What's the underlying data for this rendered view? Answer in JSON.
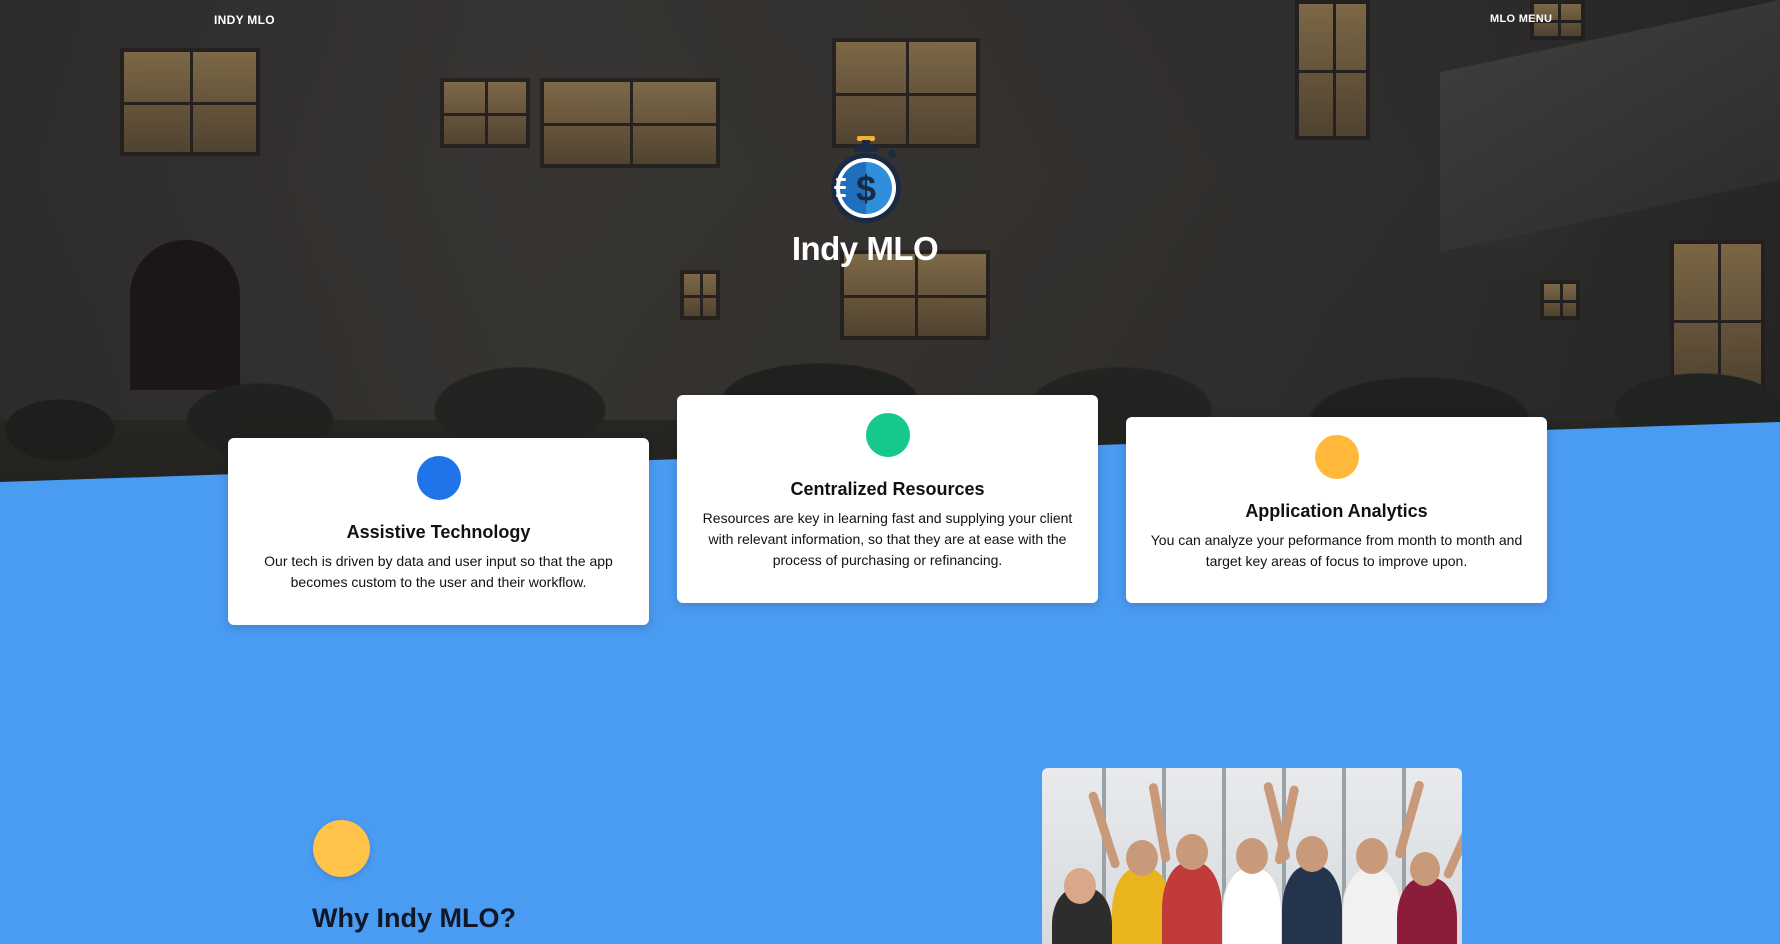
{
  "nav": {
    "brand": "INDY MLO",
    "menu_label": "MLO MENU"
  },
  "hero": {
    "title": "Indy MLO",
    "logo_icon": "stopwatch-dollar-icon"
  },
  "colors": {
    "section_blue": "#4a9bf2",
    "dot_blue": "#1f74ea",
    "dot_green": "#14c98b",
    "dot_orange": "#ffb83a",
    "dot_yellow": "#ffc34a"
  },
  "features": [
    {
      "title": "Assistive Technology",
      "description": "Our tech is driven by data and user input so that the app becomes custom to the user and their workflow."
    },
    {
      "title": "Centralized Resources",
      "description": "Resources are key in learning fast and supplying your client with relevant information, so that they are at ease with the process of purchasing or refinancing."
    },
    {
      "title": "Application Analytics",
      "description": "You can analyze your peformance from month to month and target key areas of focus to improve upon."
    }
  ],
  "why": {
    "title": "Why Indy MLO?"
  }
}
